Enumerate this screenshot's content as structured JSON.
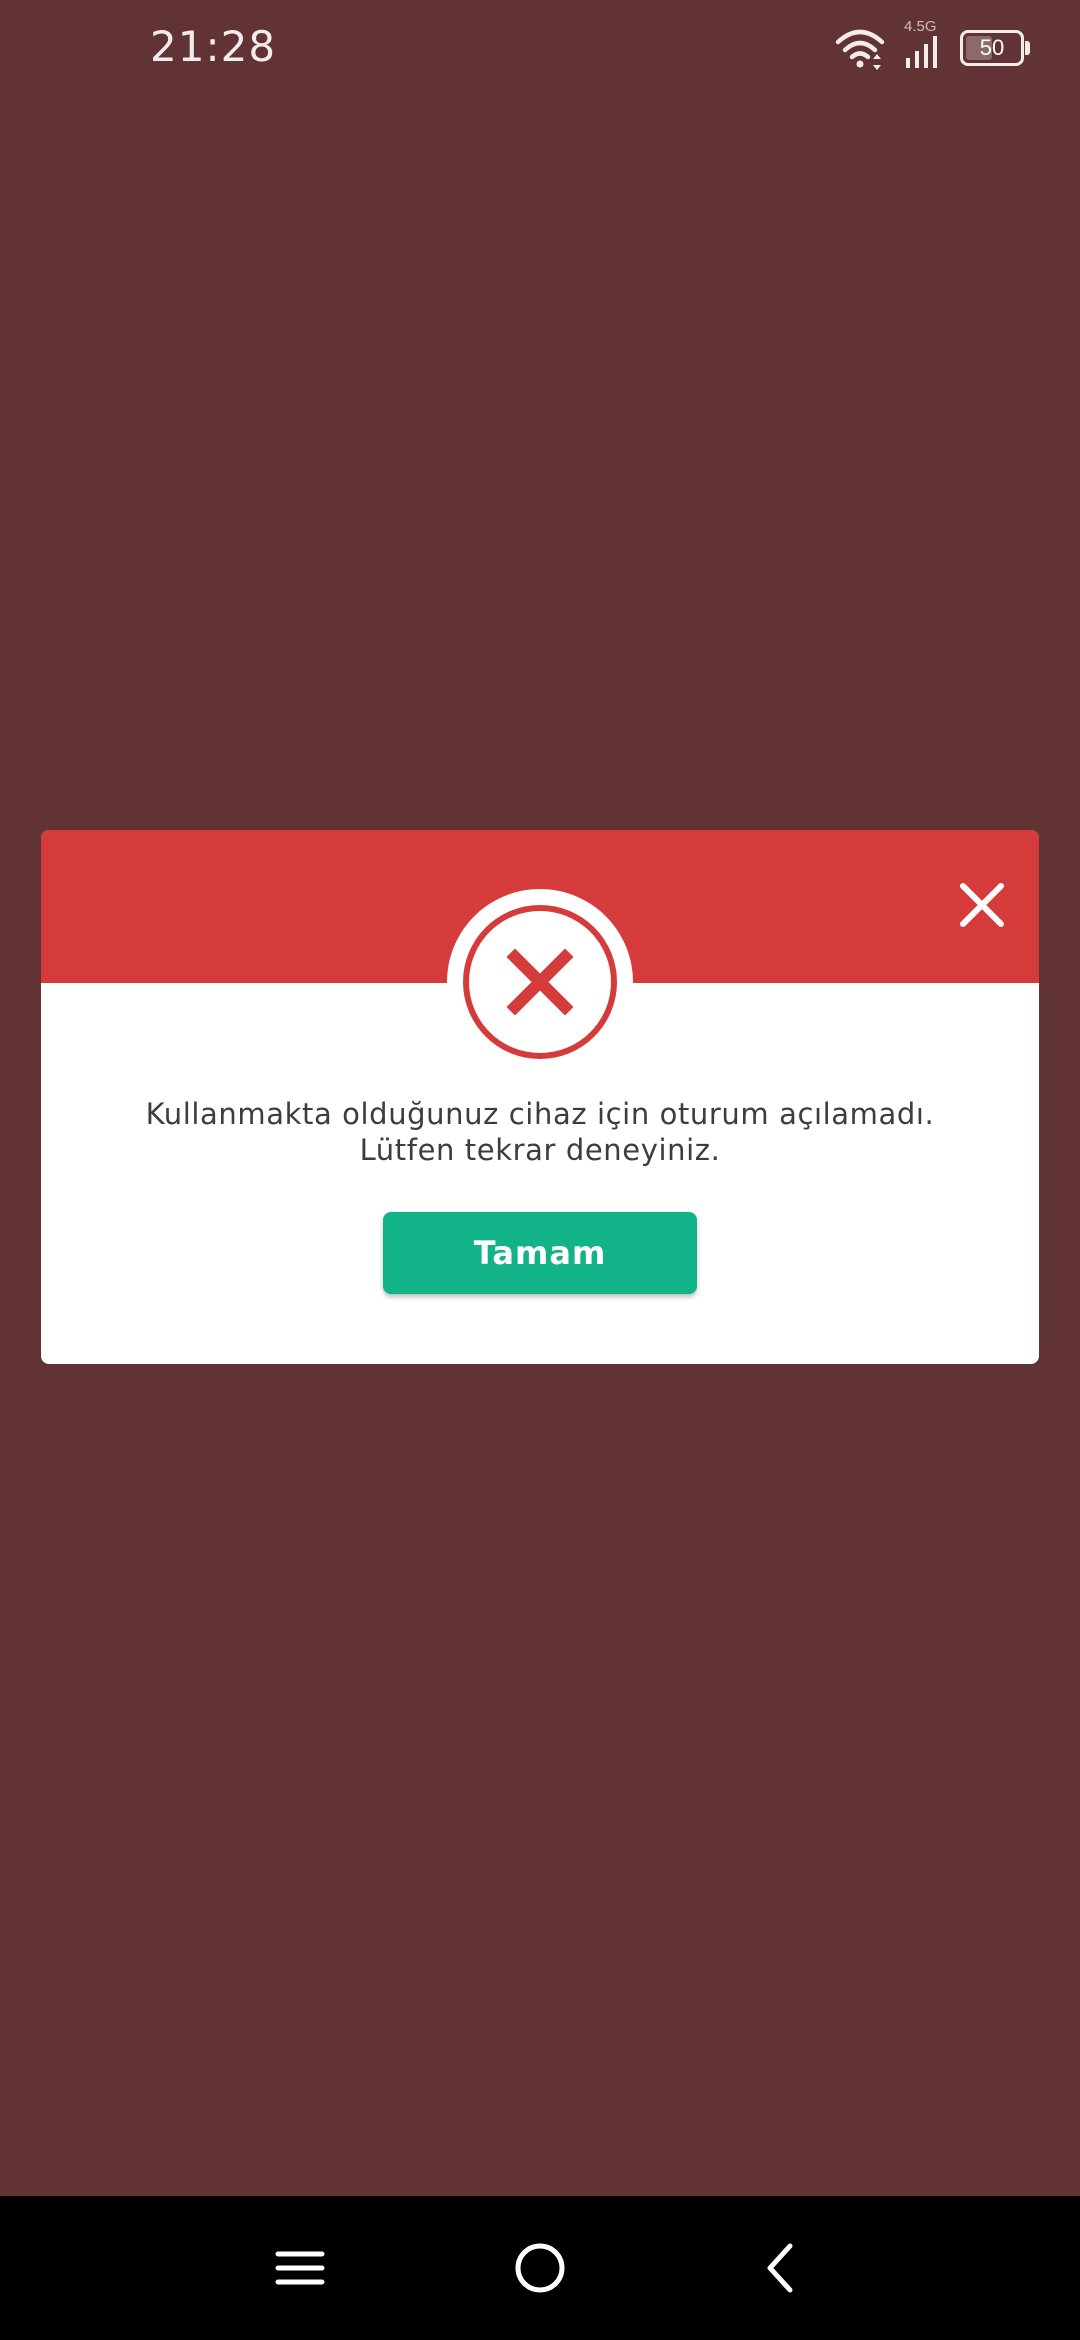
{
  "status_bar": {
    "time": "21:28",
    "network_type": "4.5G",
    "battery_level": "50",
    "icons": [
      "wifi-icon",
      "signal-icon",
      "battery-icon"
    ]
  },
  "dialog": {
    "close_icon": "close-icon",
    "status_icon": "error-x-icon",
    "message_line_1": "Kullanmakta olduğunuz cihaz için oturum açılamadı.",
    "message_line_2": "Lütfen tekrar deneyiniz.",
    "ok_button_label": "Tamam"
  },
  "nav_bar": {
    "icons": [
      "menu-icon",
      "home-icon",
      "back-icon"
    ]
  },
  "colors": {
    "backdrop": "#623335",
    "header_red": "#d43b3a",
    "button_green": "#12b389",
    "nav_bar": "#000000"
  }
}
